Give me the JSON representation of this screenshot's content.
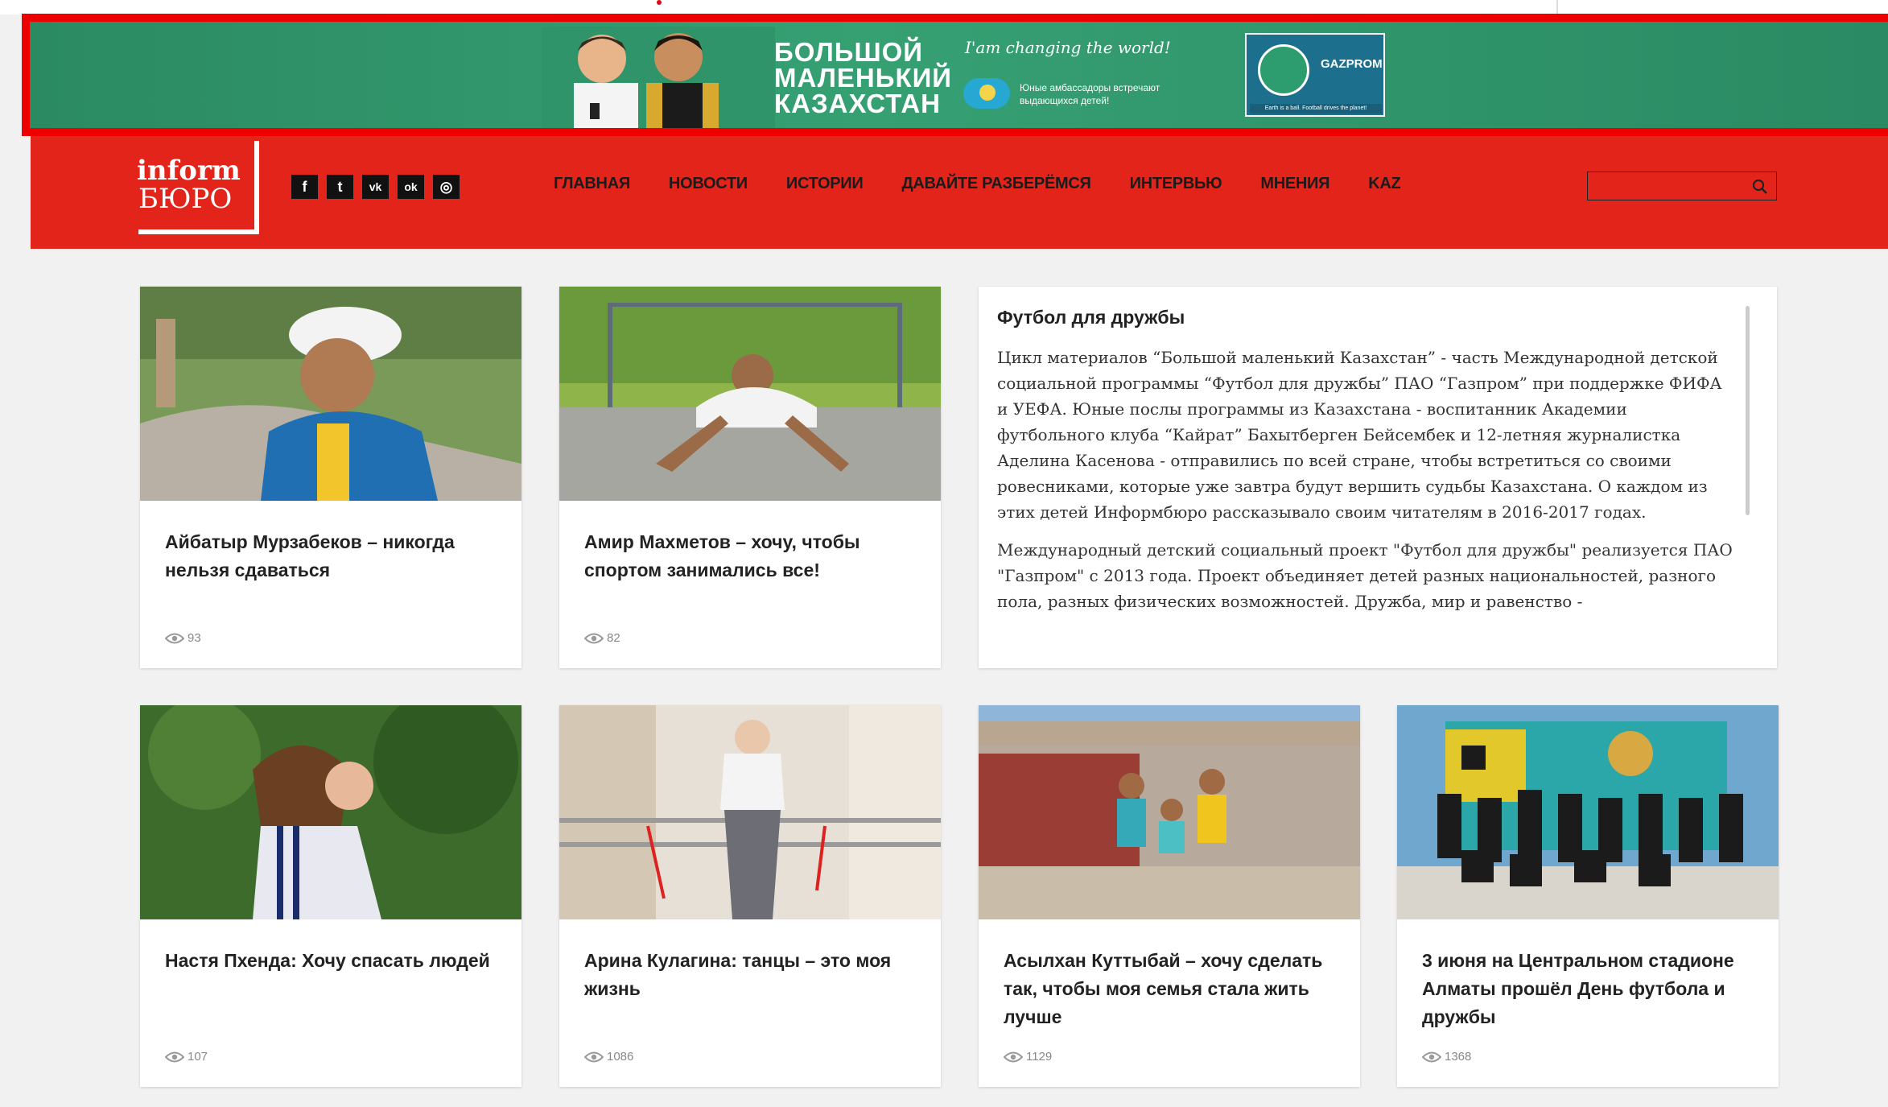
{
  "banner": {
    "title_line1": "БОЛЬШОЙ",
    "title_line2": "МАЛЕНЬКИЙ",
    "title_line3": "КАЗАХСТАН",
    "slogan": "I'am changing the world!",
    "subtitle": "Юные амбассадоры встречают выдающихся детей!",
    "sponsor": "GAZPROM",
    "footer_note": "Earth is a ball. Football drives the planet!"
  },
  "header": {
    "logo_top": "inform",
    "logo_bottom": "БЮРО",
    "socials": [
      {
        "name": "facebook-icon",
        "glyph": "f"
      },
      {
        "name": "twitter-icon",
        "glyph": "t"
      },
      {
        "name": "vk-icon",
        "glyph": "vk"
      },
      {
        "name": "odnoklassniki-icon",
        "glyph": "ok"
      },
      {
        "name": "instagram-icon",
        "glyph": "◎"
      }
    ],
    "nav": [
      "ГЛАВНАЯ",
      "НОВОСТИ",
      "ИСТОРИИ",
      "ДАВАЙТЕ РАЗБЕРЁМСЯ",
      "ИНТЕРВЬЮ",
      "МНЕНИЯ",
      "KAZ"
    ],
    "search_value": ""
  },
  "cards": [
    {
      "title": "Айбатыр Мурзабеков – никогда нельзя сдаваться",
      "views": "93"
    },
    {
      "title": "Амир Махметов – хочу, чтобы спортом занимались все!",
      "views": "82"
    },
    {
      "title": "Настя Пхенда: Хочу спасать людей",
      "views": "107"
    },
    {
      "title": "Арина Кулагина: танцы – это моя жизнь",
      "views": "1086"
    },
    {
      "title": "Асылхан Куттыбай – хочу сделать так, чтобы моя семья стала жить лучше",
      "views": "1129"
    },
    {
      "title": "3 июня на Центральном стадионе Алматы прошёл День футбола и дружбы",
      "views": "1368"
    }
  ],
  "description": {
    "title": "Футбол для дружбы",
    "paragraph1": "Цикл материалов “Большой маленький Казахстан” - часть Международной детской социальной программы “Футбол для дружбы” ПАО “Газпром” при поддержке ФИФА и УЕФА. Юные послы программы из Казахстана - воспитанник Академии футбольного клуба “Кайрат” Бахытберген Бейсембек и 12-летняя журналистка Аделина Касенова - отправились по всей стране, чтобы встретиться со своими ровесниками, которые уже завтра будут вершить судьбы Казахстана. О каждом из этих детей Информбюро рассказывало своим читателям в 2016-2017 годах.",
    "paragraph2": "Международный детский социальный проект \"Футбол для дружбы\" реализуется ПАО \"Газпром\" с 2013 года. Проект объединяет детей разных национальностей, разного пола, разных физических возможностей. Дружба, мир и равенство -"
  },
  "colors": {
    "header_red": "#e3241b",
    "banner_green": "#2e8f66",
    "page_bg": "#f1f1f1"
  }
}
